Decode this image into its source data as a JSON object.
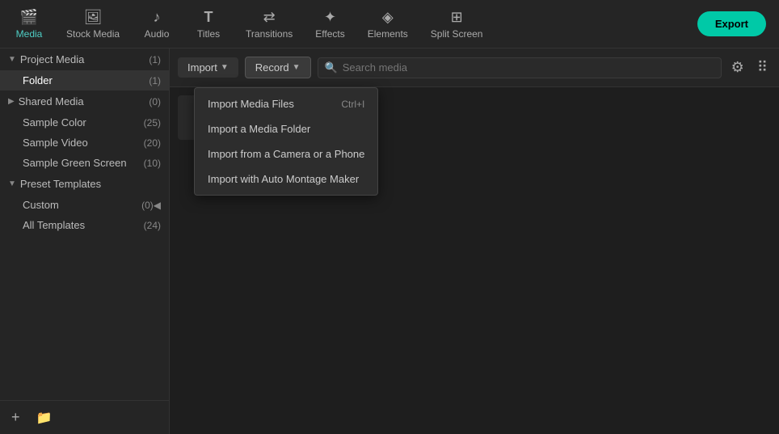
{
  "toolbar": {
    "items": [
      {
        "id": "media",
        "label": "Media",
        "icon": "🎬",
        "active": true
      },
      {
        "id": "stock-media",
        "label": "Stock Media",
        "icon": "🖼"
      },
      {
        "id": "audio",
        "label": "Audio",
        "icon": "🎵"
      },
      {
        "id": "titles",
        "label": "Titles",
        "icon": "T"
      },
      {
        "id": "transitions",
        "label": "Transitions",
        "icon": "✦"
      },
      {
        "id": "effects",
        "label": "Effects",
        "icon": "✺"
      },
      {
        "id": "elements",
        "label": "Elements",
        "icon": "◈"
      },
      {
        "id": "split-screen",
        "label": "Split Screen",
        "icon": "⊞"
      }
    ],
    "export_label": "Export"
  },
  "sidebar": {
    "project_media_label": "Project Media",
    "project_media_count": "(1)",
    "folder_label": "Folder",
    "folder_count": "(1)",
    "shared_media_label": "Shared Media",
    "shared_media_count": "(0)",
    "sample_color_label": "Sample Color",
    "sample_color_count": "(25)",
    "sample_video_label": "Sample Video",
    "sample_video_count": "(20)",
    "sample_green_screen_label": "Sample Green Screen",
    "sample_green_screen_count": "(10)",
    "preset_templates_label": "Preset Templates",
    "custom_label": "Custom",
    "custom_count": "(0)",
    "all_templates_label": "All Templates",
    "all_templates_count": "(24)",
    "footer_add_tooltip": "Add",
    "footer_folder_tooltip": "New Folder"
  },
  "content_toolbar": {
    "import_label": "Import",
    "record_label": "Record",
    "search_placeholder": "Search media"
  },
  "dropdown": {
    "items": [
      {
        "label": "Import Media Files",
        "shortcut": "Ctrl+I"
      },
      {
        "label": "Import a Media Folder",
        "shortcut": ""
      },
      {
        "label": "Import from a Camera or a Phone",
        "shortcut": ""
      },
      {
        "label": "Import with Auto Montage Maker",
        "shortcut": ""
      }
    ]
  }
}
